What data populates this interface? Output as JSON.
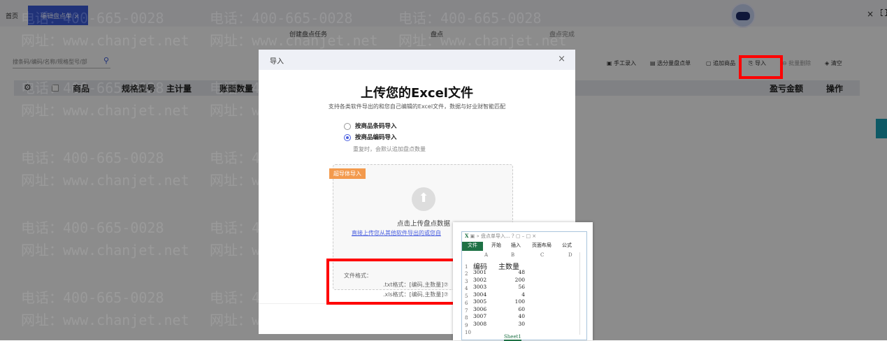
{
  "tabs": {
    "home": "首页",
    "active": "编辑盘点单 ×"
  },
  "steps": [
    "创建盘点任务",
    "盘点",
    "盘点完成"
  ],
  "search": {
    "placeholder": "搜条码/编码/名称/规格型号/部"
  },
  "toolbar": [
    "手工录入",
    "选分量盘点单",
    "追加商品",
    "导入",
    "批量删除",
    "清空"
  ],
  "table": {
    "headers": [
      "商品",
      "规格型号",
      "主计量",
      "账面数量",
      "盈亏金额",
      "操作"
    ]
  },
  "window": {
    "close": "×"
  },
  "watermark": {
    "phone": "电话：400-665-0028",
    "site": "网址：www.chanjet.net"
  },
  "modal": {
    "title": "导入",
    "close": "×",
    "heading": "上传您的Excel文件",
    "subtitle": "支持各类软件导出的和您自己编辑的Excel文件，数据与好业财智能匹配",
    "options": [
      {
        "label": "按商品条码导入",
        "checked": false
      },
      {
        "label": "按商品编码导入",
        "checked": true
      }
    ],
    "hint": "重复时，会默认追加盘点数量",
    "badge": "超导体导入",
    "upload_text": "点击上传盘点数据",
    "upload_link": "直接上传您从其他软件导出的或您自",
    "formats_label": "文件格式：",
    "formats": [
      ".txt格式：[编码,主数量]⑦",
      ".xls格式：[编码,主数量]⑦"
    ]
  },
  "excel": {
    "title": "盘点单导入...",
    "menu": [
      "文件",
      "开始",
      "插入",
      "页面布局",
      "公式"
    ],
    "columns": [
      "A",
      "B",
      "C",
      "D"
    ],
    "header": [
      "编码",
      "主数量"
    ],
    "rows": [
      [
        "3001",
        "48"
      ],
      [
        "3002",
        "200"
      ],
      [
        "3003",
        "56"
      ],
      [
        "3004",
        "4"
      ],
      [
        "3005",
        "100"
      ],
      [
        "3006",
        "60"
      ],
      [
        "3007",
        "40"
      ],
      [
        "3008",
        "30"
      ]
    ],
    "sheet": "Sheet1"
  },
  "colors": {
    "accent": "#3b5bdb",
    "highlight": "#ff0000",
    "badge": "#f39a4d"
  }
}
